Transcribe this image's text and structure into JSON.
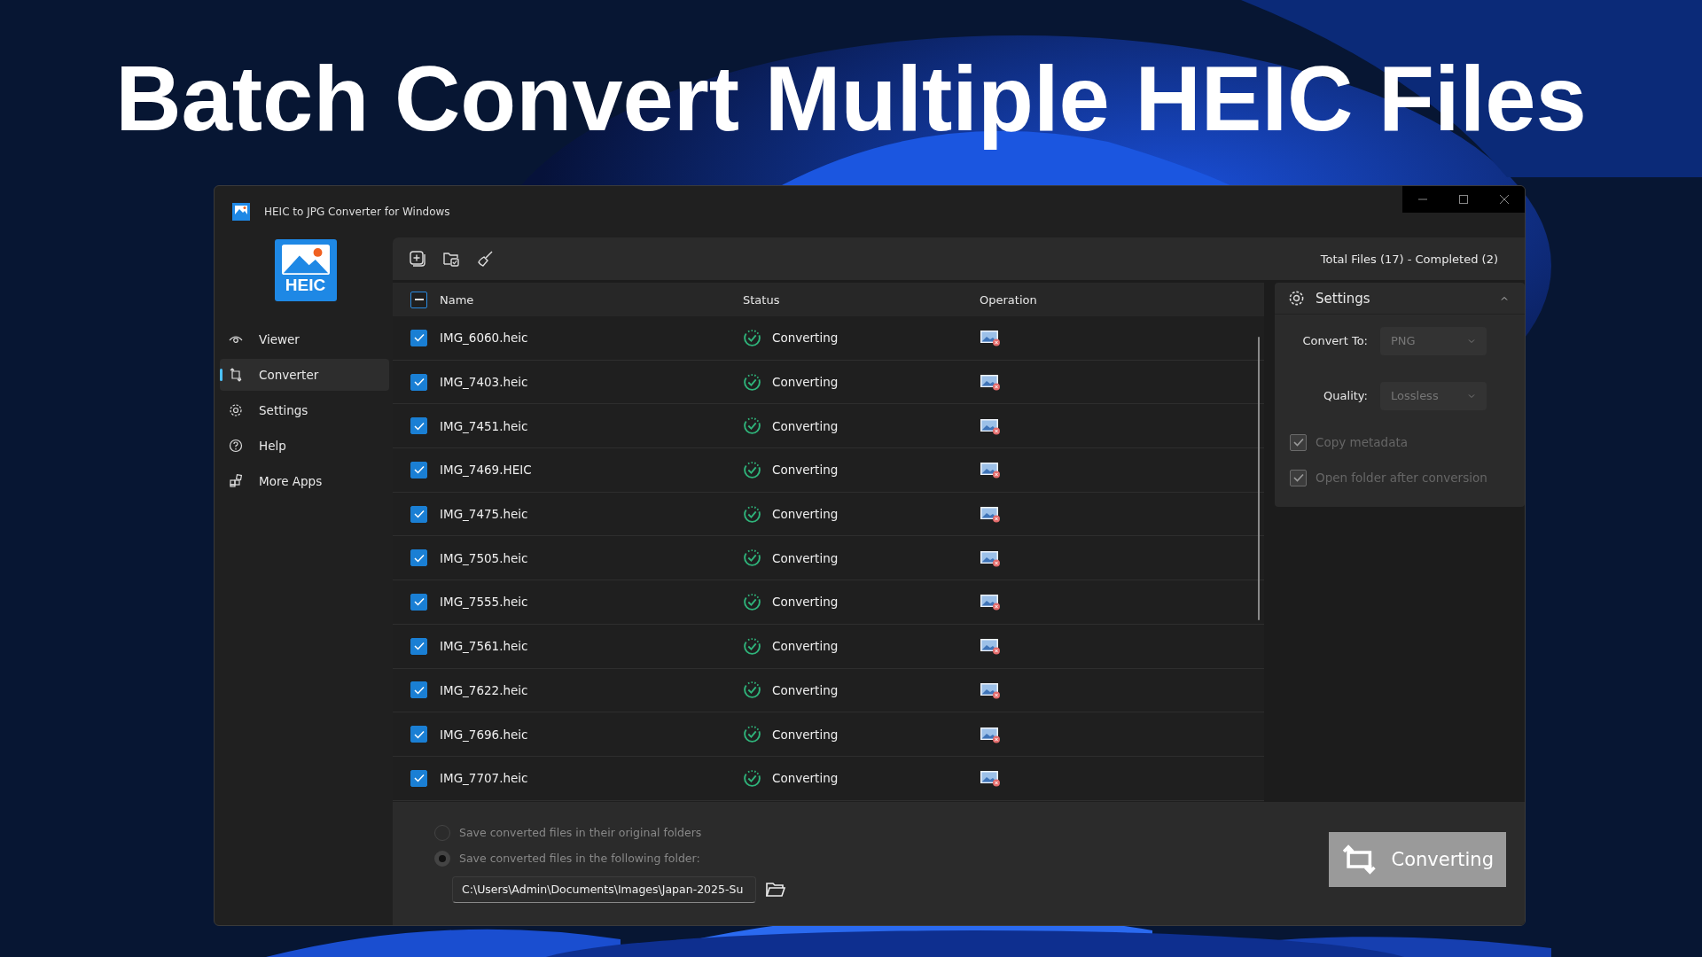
{
  "headline": "Batch Convert Multiple HEIC Files",
  "window": {
    "title": "HEIC to JPG Converter for Windows"
  },
  "logo": {
    "text": "HEIC"
  },
  "sidebar": {
    "items": [
      {
        "label": "Viewer",
        "selected": false
      },
      {
        "label": "Converter",
        "selected": true
      },
      {
        "label": "Settings",
        "selected": false
      },
      {
        "label": "Help",
        "selected": false
      },
      {
        "label": "More Apps",
        "selected": false
      }
    ]
  },
  "toolbar": {
    "summary": "Total Files (17) - Completed (2)"
  },
  "table": {
    "select_all_indeterminate": true,
    "columns": [
      "Name",
      "Status",
      "Operation"
    ],
    "rows": [
      {
        "name": "IMG_6060.heic",
        "checked": true,
        "status": "Converting"
      },
      {
        "name": "IMG_7403.heic",
        "checked": true,
        "status": "Converting"
      },
      {
        "name": "IMG_7451.heic",
        "checked": true,
        "status": "Converting"
      },
      {
        "name": "IMG_7469.HEIC",
        "checked": true,
        "status": "Converting"
      },
      {
        "name": "IMG_7475.heic",
        "checked": true,
        "status": "Converting"
      },
      {
        "name": "IMG_7505.heic",
        "checked": true,
        "status": "Converting"
      },
      {
        "name": "IMG_7555.heic",
        "checked": true,
        "status": "Converting"
      },
      {
        "name": "IMG_7561.heic",
        "checked": true,
        "status": "Converting"
      },
      {
        "name": "IMG_7622.heic",
        "checked": true,
        "status": "Converting"
      },
      {
        "name": "IMG_7696.heic",
        "checked": true,
        "status": "Converting"
      },
      {
        "name": "IMG_7707.heic",
        "checked": true,
        "status": "Converting"
      }
    ]
  },
  "settings": {
    "title": "Settings",
    "expanded": true,
    "fields": [
      {
        "label": "Convert To:",
        "value": "PNG"
      },
      {
        "label": "Quality:",
        "value": "Lossless"
      }
    ],
    "options": [
      {
        "label": "Copy metadata",
        "checked": true,
        "disabled": true
      },
      {
        "label": "Open folder after conversion",
        "checked": true,
        "disabled": true
      }
    ]
  },
  "output": {
    "options": [
      {
        "label": "Save converted files in their original folders",
        "selected": false
      },
      {
        "label": "Save converted files in the following folder:",
        "selected": true
      }
    ],
    "folder": "C:\\Users\\Admin\\Documents\\Images\\Japan-2025-Su"
  },
  "convert_button": {
    "label": "Converting",
    "disabled": true
  }
}
